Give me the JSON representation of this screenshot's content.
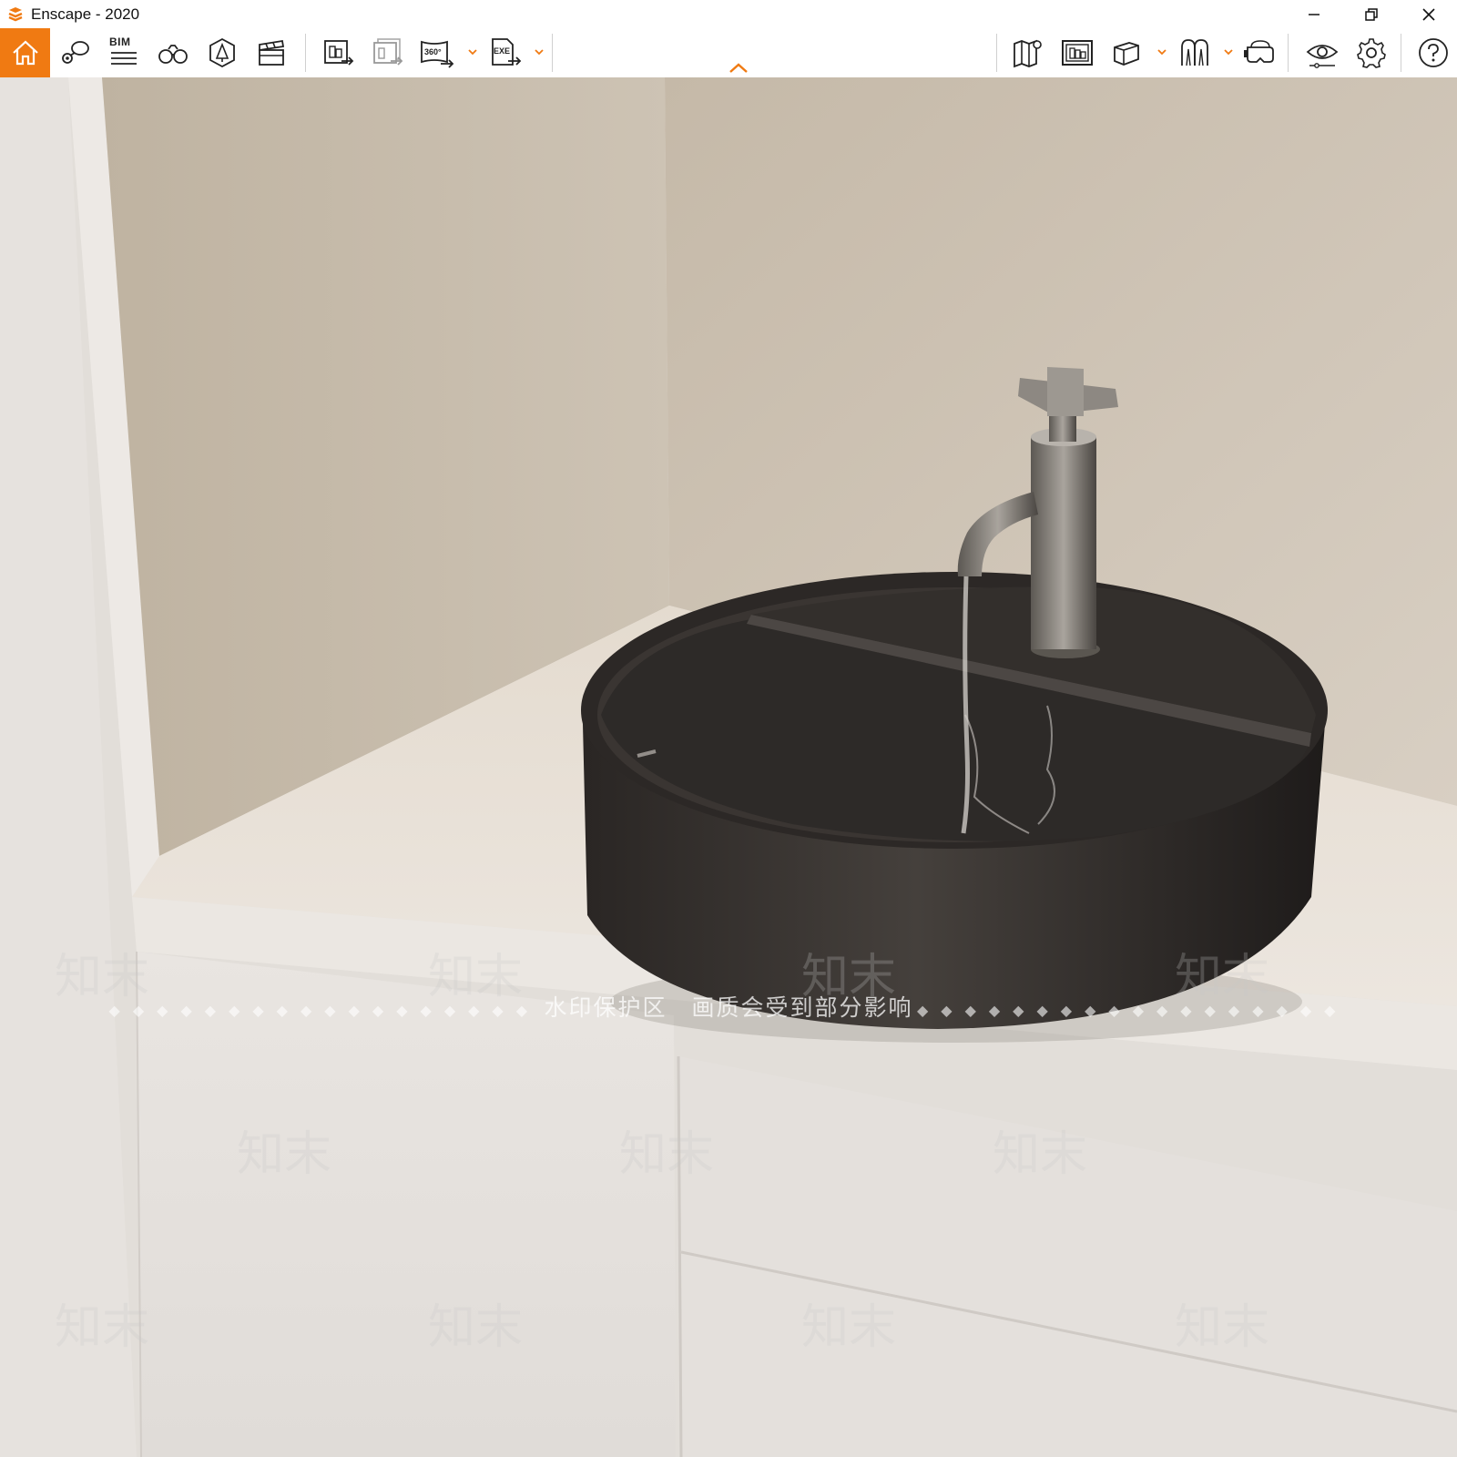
{
  "window": {
    "title": "Enscape - 2020",
    "controls": [
      "minimize",
      "restore",
      "close"
    ]
  },
  "toolbar": {
    "accent_color": "#f07a12",
    "left_group": [
      {
        "name": "home",
        "icon": "home-icon",
        "active": true
      },
      {
        "name": "views",
        "icon": "location-views-icon"
      },
      {
        "name": "bim",
        "icon": "bim-icon",
        "label": "BIM"
      },
      {
        "name": "binoculars",
        "icon": "binoculars-icon"
      },
      {
        "name": "assets",
        "icon": "asset-library-icon"
      },
      {
        "name": "video-editor",
        "icon": "clapperboard-icon"
      },
      {
        "name": "screenshot",
        "icon": "render-export-icon"
      },
      {
        "name": "batch-render",
        "icon": "batch-render-icon"
      },
      {
        "name": "panorama",
        "icon": "panorama-360-icon",
        "label": "360°",
        "has_dropdown": true
      },
      {
        "name": "export-exe",
        "icon": "export-exe-icon",
        "label": "EXE",
        "has_dropdown": true
      }
    ],
    "right_group": [
      {
        "name": "map",
        "icon": "map-icon"
      },
      {
        "name": "minimap",
        "icon": "minimap-icon"
      },
      {
        "name": "view-mode",
        "icon": "cube-icon",
        "has_dropdown": true
      },
      {
        "name": "walk-mode",
        "icon": "walk-icon",
        "has_dropdown": true
      },
      {
        "name": "vr",
        "icon": "vr-headset-icon"
      },
      {
        "name": "visual-settings",
        "icon": "eye-settings-icon"
      },
      {
        "name": "settings",
        "icon": "gear-icon"
      },
      {
        "name": "help",
        "icon": "help-icon"
      }
    ]
  },
  "viewport": {
    "description_icon": "render-viewport",
    "watermark": {
      "notice": "水印保护区　画质会受到部分影响",
      "brand": "知末"
    }
  }
}
